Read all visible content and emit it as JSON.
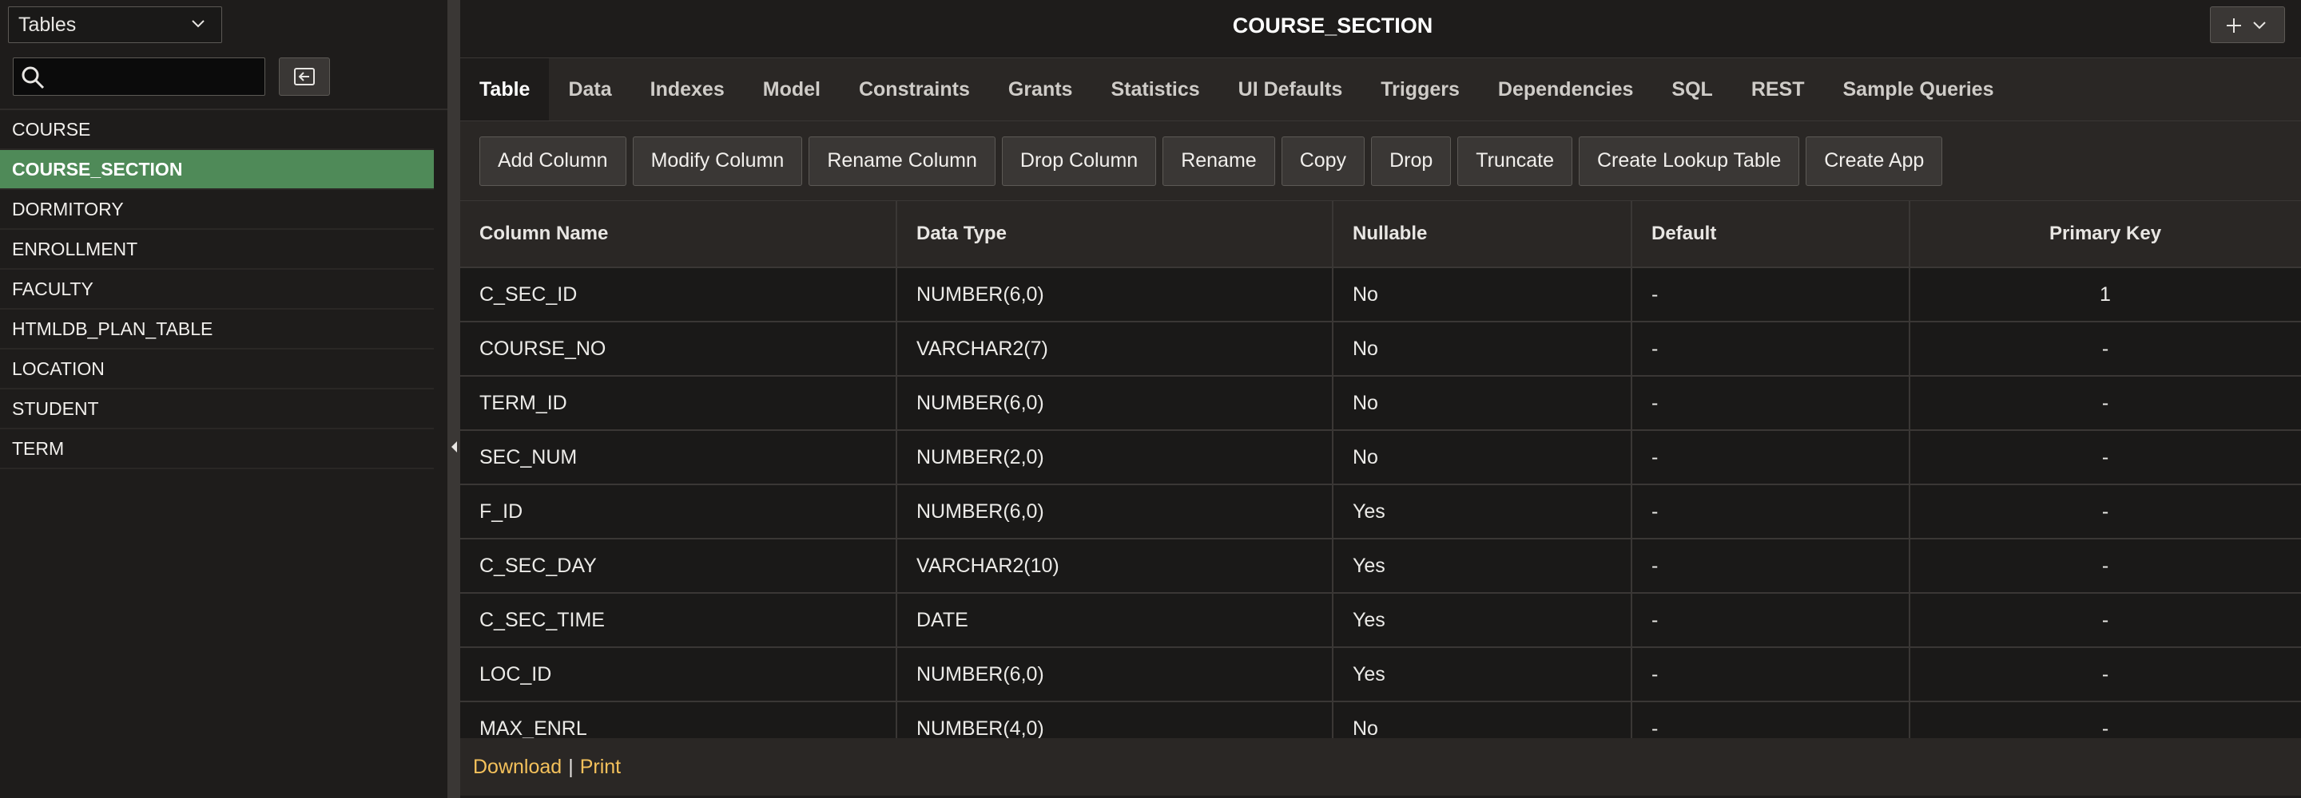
{
  "sidebar": {
    "object_type": "Tables",
    "search": {
      "value": "",
      "placeholder": ""
    },
    "items": [
      {
        "label": "COURSE"
      },
      {
        "label": "COURSE_SECTION",
        "selected": true
      },
      {
        "label": "DORMITORY"
      },
      {
        "label": "ENROLLMENT"
      },
      {
        "label": "FACULTY"
      },
      {
        "label": "HTMLDB_PLAN_TABLE"
      },
      {
        "label": "LOCATION"
      },
      {
        "label": "STUDENT"
      },
      {
        "label": "TERM"
      }
    ]
  },
  "header": {
    "title": "COURSE_SECTION"
  },
  "tabs": [
    "Table",
    "Data",
    "Indexes",
    "Model",
    "Constraints",
    "Grants",
    "Statistics",
    "UI Defaults",
    "Triggers",
    "Dependencies",
    "SQL",
    "REST",
    "Sample Queries"
  ],
  "active_tab": "Table",
  "toolbar": [
    "Add Column",
    "Modify Column",
    "Rename Column",
    "Drop Column",
    "Rename",
    "Copy",
    "Drop",
    "Truncate",
    "Create Lookup Table",
    "Create App"
  ],
  "grid": {
    "headers": [
      "Column Name",
      "Data Type",
      "Nullable",
      "Default",
      "Primary Key"
    ],
    "rows": [
      [
        "C_SEC_ID",
        "NUMBER(6,0)",
        "No",
        "-",
        "1"
      ],
      [
        "COURSE_NO",
        "VARCHAR2(7)",
        "No",
        "-",
        "-"
      ],
      [
        "TERM_ID",
        "NUMBER(6,0)",
        "No",
        "-",
        "-"
      ],
      [
        "SEC_NUM",
        "NUMBER(2,0)",
        "No",
        "-",
        "-"
      ],
      [
        "F_ID",
        "NUMBER(6,0)",
        "Yes",
        "-",
        "-"
      ],
      [
        "C_SEC_DAY",
        "VARCHAR2(10)",
        "Yes",
        "-",
        "-"
      ],
      [
        "C_SEC_TIME",
        "DATE",
        "Yes",
        "-",
        "-"
      ],
      [
        "LOC_ID",
        "NUMBER(6,0)",
        "Yes",
        "-",
        "-"
      ],
      [
        "MAX_ENRL",
        "NUMBER(4,0)",
        "No",
        "-",
        "-"
      ]
    ]
  },
  "footer": {
    "download": "Download",
    "separator": "|",
    "print": "Print"
  },
  "colors": {
    "selected_item": "#4f8a58",
    "footer_link": "#f4c15b",
    "background": "#1e1c1b"
  }
}
